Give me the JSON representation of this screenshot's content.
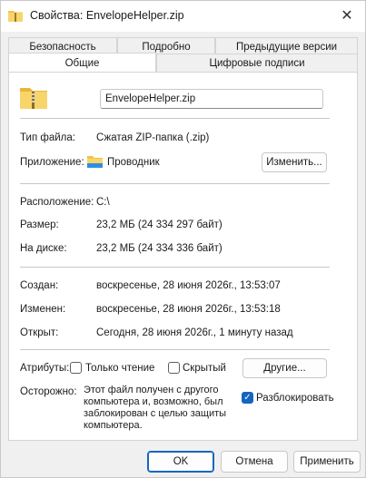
{
  "window": {
    "title": "Свойства: EnvelopeHelper.zip",
    "close_glyph": "✕"
  },
  "tabs": {
    "row1": [
      {
        "label": "Безопасность"
      },
      {
        "label": "Подробно"
      },
      {
        "label": "Предыдущие версии"
      }
    ],
    "row2": [
      {
        "label": "Общие",
        "active": true
      },
      {
        "label": "Цифровые подписи"
      }
    ]
  },
  "general": {
    "file_name": "EnvelopeHelper.zip",
    "type_label": "Тип файла:",
    "type_value": "Сжатая ZIP-папка (.zip)",
    "app_label": "Приложение:",
    "app_value": "Проводник",
    "change_button": "Изменить...",
    "location_label": "Расположение:",
    "location_value": "C:\\",
    "size_label": "Размер:",
    "size_value": "23,2 МБ (24 334 297 байт)",
    "disk_label": "На диске:",
    "disk_value": "23,2 МБ (24 334 336 байт)",
    "created_label": "Создан:",
    "created_value": "воскресенье, 28 июня 2026г., 13:53:07",
    "modified_label": "Изменен:",
    "modified_value": "воскресенье, 28 июня 2026г., 13:53:18",
    "opened_label": "Открыт:",
    "opened_value": "Сегодня, 28 июня 2026г., 1 минуту назад",
    "attributes_label": "Атрибуты:",
    "readonly_label": "Только чтение",
    "readonly_checked": false,
    "hidden_label": "Скрытый",
    "hidden_checked": false,
    "other_button": "Другие...",
    "caution_label": "Осторожно:",
    "caution_text": "Этот файл получен с другого компьютера и, возможно, был заблокирован с целью защиты компьютера.",
    "unblock_label": "Разблокировать",
    "unblock_checked": true
  },
  "footer": {
    "ok": "OK",
    "cancel": "Отмена",
    "apply": "Применить"
  },
  "icons": {
    "zip_folder": "zip-folder-icon",
    "explorer": "explorer-folder-icon"
  },
  "colors": {
    "accent": "#1565c0",
    "folder": "#f4c542"
  }
}
